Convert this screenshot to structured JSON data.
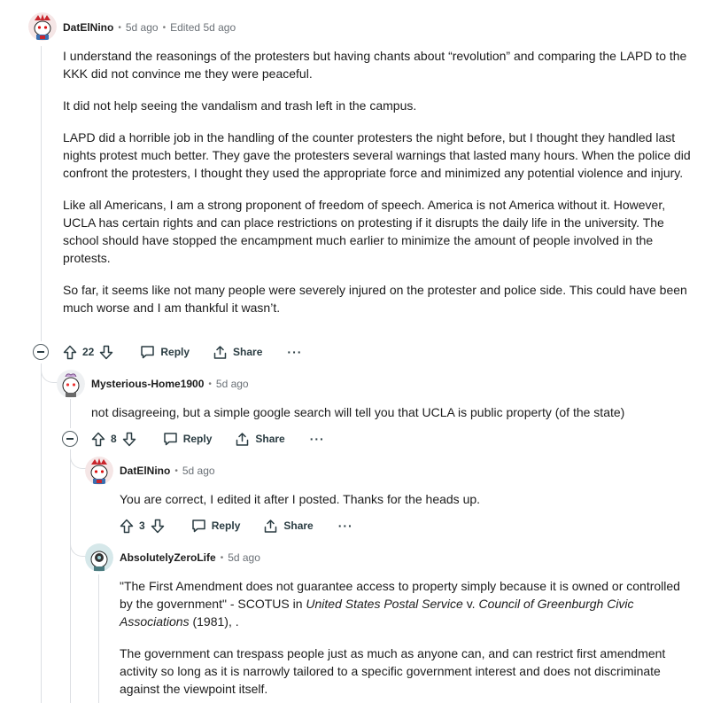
{
  "comments": [
    {
      "author": "DatElNino",
      "time": "5d ago",
      "edited": "Edited 5d ago",
      "paragraphs": [
        "I understand the reasonings of the protesters but having chants about “revolution” and comparing the LAPD to the KKK did not convince me they were peaceful.",
        "It did not help seeing the vandalism and trash left in the campus.",
        "LAPD did a horrible job in the handling of the counter protesters the night before, but I thought they handled last nights protest much better. They gave the protesters several warnings that lasted many hours. When the police did confront the protesters, I thought they used the appropriate force and minimized any potential violence and injury.",
        "Like all Americans, I am a strong proponent of freedom of speech. America is not America without it. However, UCLA has certain rights and can place restrictions on protesting if it disrupts the daily life in the university. The school should have stopped the encampment much earlier to minimize the amount of people involved in the protests.",
        "So far, it seems like not many people were severely injured on the protester and police side. This could have been much worse and I am thankful it wasn’t."
      ],
      "votes": "22",
      "reply": "Reply",
      "share": "Share"
    },
    {
      "author": "Mysterious-Home1900",
      "time": "5d ago",
      "paragraphs": [
        "not disagreeing, but a simple google search will tell you that UCLA is public property (of the state)"
      ],
      "votes": "8",
      "reply": "Reply",
      "share": "Share"
    },
    {
      "author": "DatElNino",
      "time": "5d ago",
      "paragraphs": [
        "You are correct, I edited it after I posted. Thanks for the heads up."
      ],
      "votes": "3",
      "reply": "Reply",
      "share": "Share"
    },
    {
      "author": "AbsolutelyZeroLife",
      "time": "5d ago",
      "quote": {
        "before": "\"The First Amendment does not guarantee access to property simply because it is owned or controlled by the government\" - SCOTUS in ",
        "case_a": "United States Postal Service",
        "mid": " v. ",
        "case_b": "Council of Greenburgh Civic Associations",
        "after": " (1981), ."
      },
      "paragraphs": [
        "The government can trespass people just as much as anyone can, and can restrict first amendment activity so long as it is narrowly tailored to a specific government interest and does not discriminate against the viewpoint itself."
      ]
    }
  ],
  "icons": {
    "upvote": "arrow-up-icon",
    "downvote": "arrow-down-icon",
    "reply": "comment-bubble-icon",
    "share": "share-icon",
    "more": "more-horizontal-icon",
    "collapse": "collapse-minus-icon"
  },
  "colors": {
    "text": "#1c1c1c",
    "meta": "#6b7177",
    "thread": "#dcdfe3"
  }
}
